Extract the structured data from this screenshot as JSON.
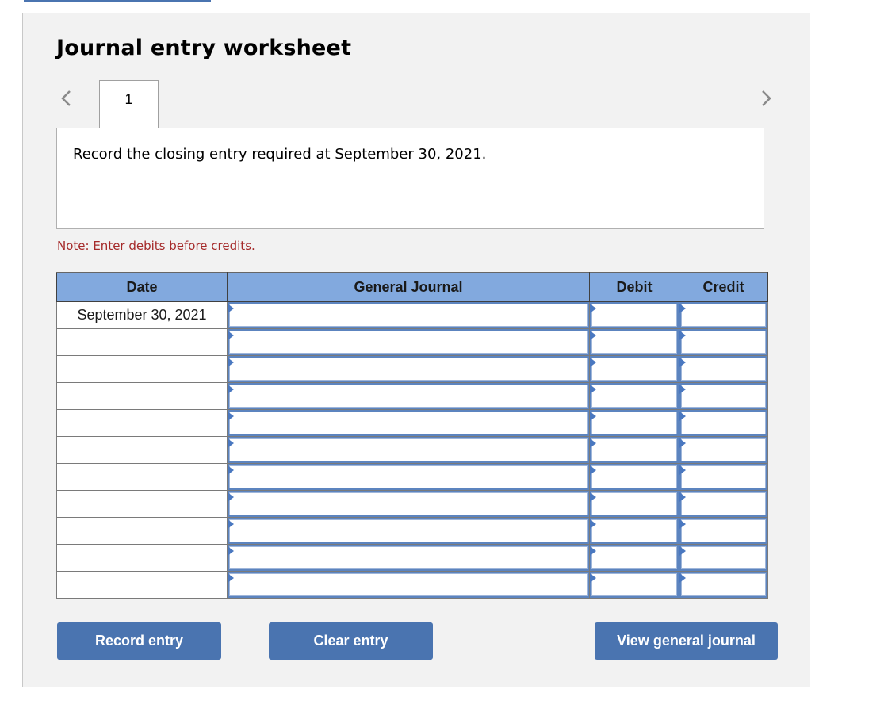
{
  "header": {
    "title": "Journal entry worksheet"
  },
  "navigation": {
    "prev_icon": "chevron-left-icon",
    "next_icon": "chevron-right-icon",
    "tabs": [
      {
        "label": "1",
        "active": true
      }
    ]
  },
  "question": {
    "text": "Record the closing entry required at September 30, 2021."
  },
  "note": {
    "text": "Note: Enter debits before credits.",
    "color": "#a52a2a"
  },
  "journal": {
    "columns": [
      "Date",
      "General Journal",
      "Debit",
      "Credit"
    ],
    "header_color": "#82a9de",
    "rows": [
      {
        "date": "September 30, 2021",
        "account": "",
        "debit": "",
        "credit": ""
      },
      {
        "date": "",
        "account": "",
        "debit": "",
        "credit": ""
      },
      {
        "date": "",
        "account": "",
        "debit": "",
        "credit": ""
      },
      {
        "date": "",
        "account": "",
        "debit": "",
        "credit": ""
      },
      {
        "date": "",
        "account": "",
        "debit": "",
        "credit": ""
      },
      {
        "date": "",
        "account": "",
        "debit": "",
        "credit": ""
      },
      {
        "date": "",
        "account": "",
        "debit": "",
        "credit": ""
      },
      {
        "date": "",
        "account": "",
        "debit": "",
        "credit": ""
      },
      {
        "date": "",
        "account": "",
        "debit": "",
        "credit": ""
      },
      {
        "date": "",
        "account": "",
        "debit": "",
        "credit": ""
      },
      {
        "date": "",
        "account": "",
        "debit": "",
        "credit": ""
      }
    ]
  },
  "buttons": {
    "record": "Record entry",
    "clear": "Clear entry",
    "view": "View general journal",
    "color": "#4a74b0"
  }
}
